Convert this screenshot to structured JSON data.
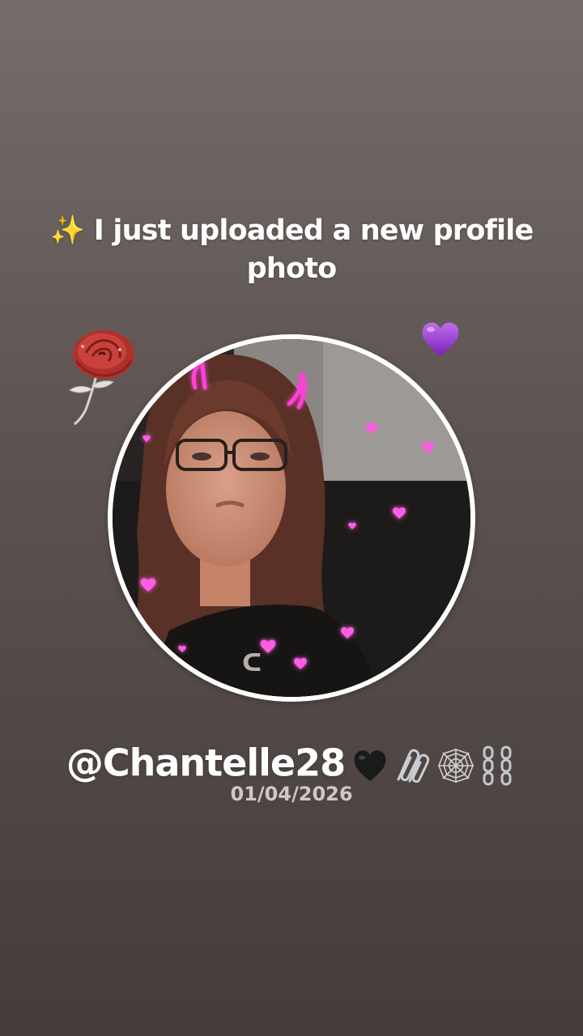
{
  "story": {
    "headline": "✨ I just uploaded a new profile photo",
    "username": "@Chantelle28",
    "username_emoji_icons": [
      "black-heart-icon",
      "paperclips-icon",
      "spider-web-icon",
      "chains-icon"
    ],
    "date": "01/04/2026"
  },
  "stickers": {
    "left": "rose-icon",
    "right": "purple-heart-icon"
  },
  "profile_photo": {
    "subject": "selfie with glowing pink devil horns and hearts filter",
    "ring_color": "#ffffff"
  },
  "colors": {
    "background_top": "#756d69",
    "background_bottom": "#463d3a",
    "text": "#ffffff",
    "date_text": "#cfc8c5",
    "accent_pink": "#ff3fd8",
    "accent_purple": "#9b3ad6"
  }
}
